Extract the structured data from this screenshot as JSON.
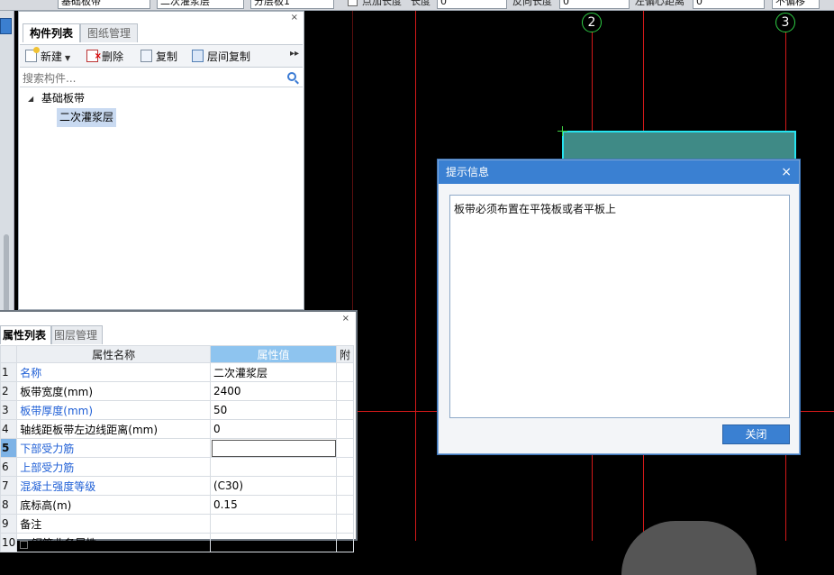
{
  "toolbar_top": {
    "field1": "基础板带",
    "field2": "二次灌浆层",
    "field3": "分层板1",
    "checkbox_label": "点加长度",
    "len_label": "长度",
    "len_value": "0",
    "reverse_label": "反向长度",
    "reverse_value": "0",
    "offset_label": "左偏心距离",
    "offset_value": "0",
    "mode_value": "不偏移"
  },
  "component_panel": {
    "tabs": [
      "构件列表",
      "图纸管理"
    ],
    "toolbar": {
      "new_label": "新建",
      "delete_label": "删除",
      "copy_label": "复制",
      "floor_copy_label": "层间复制"
    },
    "search_placeholder": "搜索构件...",
    "tree": {
      "root_label": "基础板带",
      "child_label": "二次灌浆层"
    }
  },
  "property_panel": {
    "tabs": [
      "属性列表",
      "图层管理"
    ],
    "headers": {
      "name": "属性名称",
      "value": "属性值",
      "extra": "附"
    },
    "rows": [
      {
        "num": "1",
        "name": "名称",
        "value": "二次灌浆层"
      },
      {
        "num": "2",
        "name": "板带宽度(mm)",
        "value": "2400"
      },
      {
        "num": "3",
        "name": "板带厚度(mm)",
        "value": "50"
      },
      {
        "num": "4",
        "name": "轴线距板带左边线距离(mm)",
        "value": "0"
      },
      {
        "num": "5",
        "name": "下部受力筋",
        "value": ""
      },
      {
        "num": "6",
        "name": "上部受力筋",
        "value": ""
      },
      {
        "num": "7",
        "name": "混凝土强度等级",
        "value": "(C30)"
      },
      {
        "num": "8",
        "name": "底标高(m)",
        "value": "0.15"
      },
      {
        "num": "9",
        "name": "备注",
        "value": ""
      },
      {
        "num": "10",
        "name": "钢筋业务属性",
        "value": ""
      }
    ]
  },
  "canvas": {
    "axis_labels": [
      "2",
      "3"
    ]
  },
  "dialog": {
    "title": "提示信息",
    "message": "板带必须布置在平筏板或者平板上",
    "close_button": "关闭"
  },
  "colors": {
    "axis_line": "#d31919",
    "axis_circle": "#2fcf45",
    "slab_fill": "#3f8a86",
    "slab_border": "#26e3ef",
    "dialog_title": "#3a80d2"
  }
}
